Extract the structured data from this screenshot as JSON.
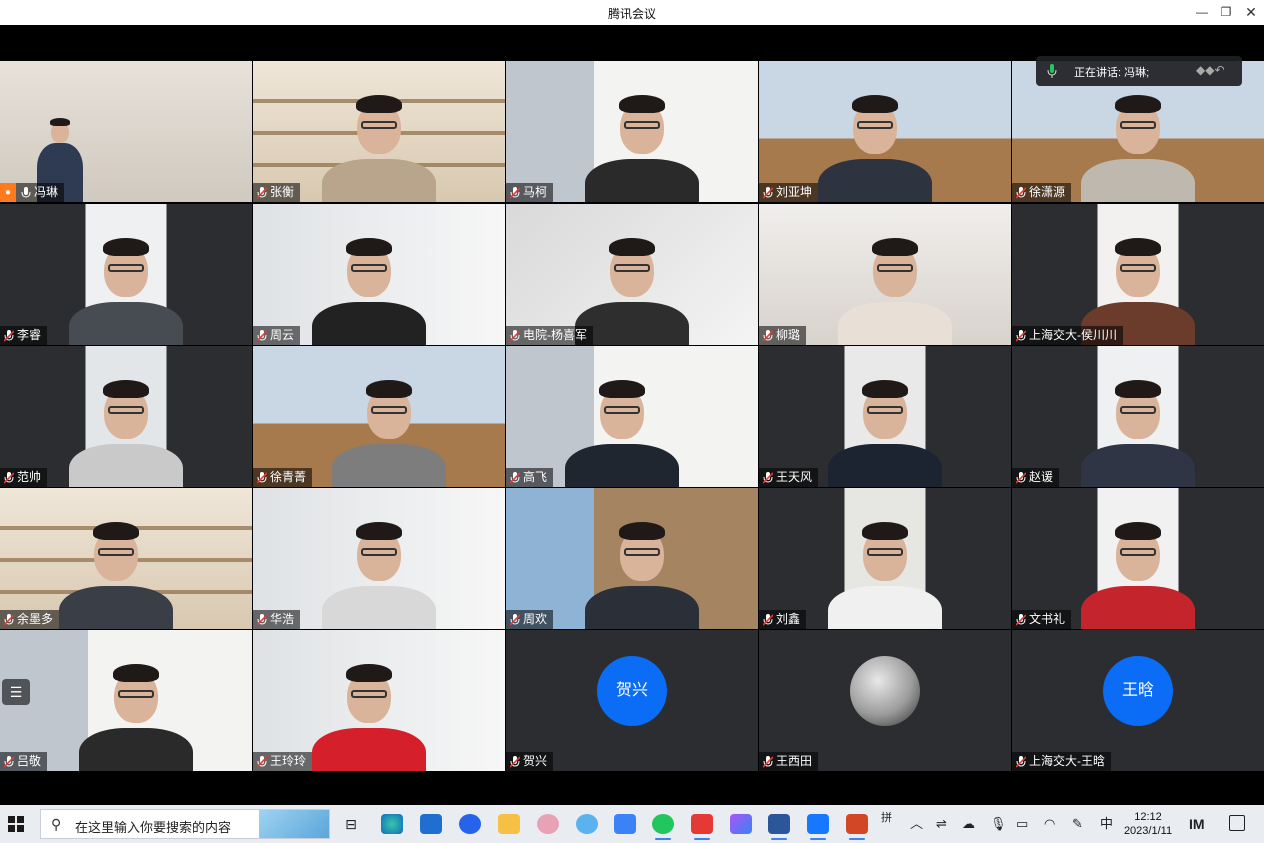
{
  "window": {
    "title": "腾讯会议",
    "minimize_icon": "—",
    "restore_icon": "❐",
    "close_icon": "✕"
  },
  "speaking": {
    "label": "正在讲话: 冯琳;"
  },
  "participants": [
    {
      "name": "冯琳"
    },
    {
      "name": "张衡"
    },
    {
      "name": "马柯"
    },
    {
      "name": "刘亚坤"
    },
    {
      "name": "徐潇源"
    },
    {
      "name": "李睿"
    },
    {
      "name": "周云"
    },
    {
      "name": "电院-杨喜军"
    },
    {
      "name": "柳璐"
    },
    {
      "name": "上海交大-侯川川"
    },
    {
      "name": "范帅"
    },
    {
      "name": "徐青菁"
    },
    {
      "name": "高飞"
    },
    {
      "name": "王天风"
    },
    {
      "name": "赵谖"
    },
    {
      "name": "余墨多"
    },
    {
      "name": "华浩"
    },
    {
      "name": "周欢"
    },
    {
      "name": "刘鑫"
    },
    {
      "name": "文书礼"
    },
    {
      "name": "吕敬"
    },
    {
      "name": "王玲玲"
    },
    {
      "name": "贺兴",
      "avatar_text": "贺兴"
    },
    {
      "name": "王西田"
    },
    {
      "name": "上海交大-王晗",
      "avatar_text": "王晗"
    }
  ],
  "taskbar": {
    "search_placeholder": "在这里输入你要搜索的内容",
    "ime": "拼",
    "lang": "中",
    "time": "12:12",
    "date": "2023/1/11"
  },
  "colors": {
    "avatar_blue": "#0b6cf5",
    "tile_bg": "#2b2d30",
    "speaking_green": "#22c55e"
  }
}
